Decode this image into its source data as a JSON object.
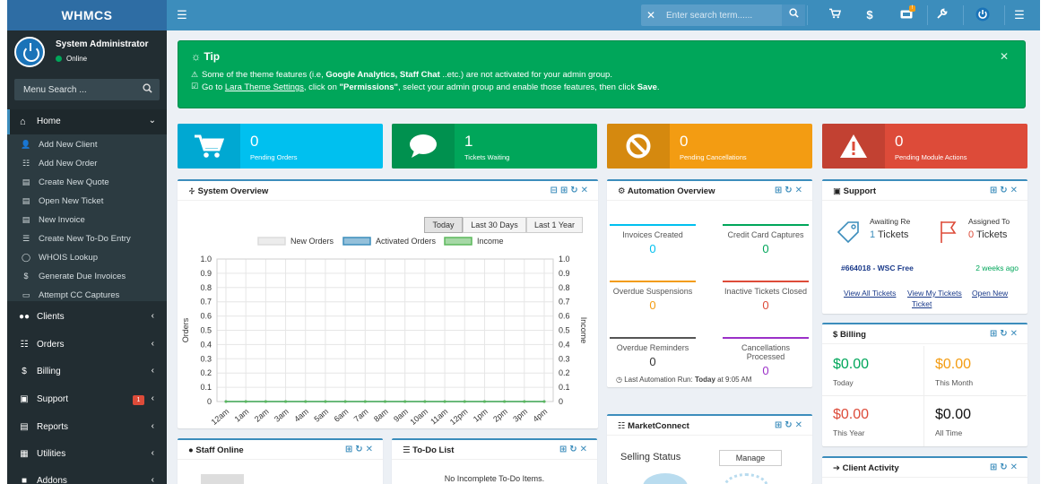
{
  "brand": "WHMCS",
  "topbar": {
    "search_placeholder": "Enter search term......",
    "icons": [
      "hamburger-icon",
      "close-icon",
      "search-icon",
      "cart-icon",
      "dollar-icon",
      "ticket-icon",
      "wrench-icon",
      "power-icon",
      "menu-icon"
    ]
  },
  "user": {
    "name": "System Administrator",
    "status": "Online"
  },
  "sidebar": {
    "search_placeholder": "Menu Search ...",
    "home_label": "Home",
    "submenu": [
      "Add New Client",
      "Add New Order",
      "Create New Quote",
      "Open New Ticket",
      "New Invoice",
      "Create New To-Do Entry",
      "WHOIS Lookup",
      "Generate Due Invoices",
      "Attempt CC Captures"
    ],
    "items": [
      {
        "label": "Clients"
      },
      {
        "label": "Orders"
      },
      {
        "label": "Billing"
      },
      {
        "label": "Support",
        "badge": "1"
      },
      {
        "label": "Reports"
      },
      {
        "label": "Utilities"
      },
      {
        "label": "Addons"
      }
    ]
  },
  "tip": {
    "title": "Tip",
    "line1_a": "Some of the theme features (i.e, ",
    "line1_b": "Google Analytics, Staff Chat",
    "line1_c": " ..etc.) are not activated for your admin group.",
    "line2_a": "Go to ",
    "line2_link": "Lara Theme Settings",
    "line2_b": ", click on ",
    "line2_c": "\"Permissions\"",
    "line2_d": ", select your admin group and enable those features, then click ",
    "line2_e": "Save",
    "line2_f": "."
  },
  "infoboxes": [
    {
      "value": "0",
      "label": "Pending Orders",
      "color": "#00c0ef"
    },
    {
      "value": "1",
      "label": "Tickets Waiting",
      "color": "#00a65a"
    },
    {
      "value": "0",
      "label": "Pending Cancellations",
      "color": "#f39c12"
    },
    {
      "value": "0",
      "label": "Pending Module Actions",
      "color": "#dd4b39"
    }
  ],
  "system_overview": {
    "title": "System Overview",
    "ranges": [
      "Today",
      "Last 30 Days",
      "Last 1 Year"
    ],
    "selected": "Today"
  },
  "chart_data": {
    "type": "line",
    "x": [
      "12am",
      "1am",
      "2am",
      "3am",
      "4am",
      "5am",
      "6am",
      "7am",
      "8am",
      "9am",
      "10am",
      "11am",
      "12pm",
      "1pm",
      "2pm",
      "3pm",
      "4pm"
    ],
    "series": [
      {
        "name": "New Orders",
        "color": "#dcdcdc",
        "values": [
          0,
          0,
          0,
          0,
          0,
          0,
          0,
          0,
          0,
          0,
          0,
          0,
          0,
          0,
          0,
          0,
          0
        ]
      },
      {
        "name": "Activated Orders",
        "color": "#3c8dbc",
        "values": [
          0,
          0,
          0,
          0,
          0,
          0,
          0,
          0,
          0,
          0,
          0,
          0,
          0,
          0,
          0,
          0,
          0
        ]
      },
      {
        "name": "Income",
        "color": "#5cb85c",
        "values": [
          0,
          0,
          0,
          0,
          0,
          0,
          0,
          0,
          0,
          0,
          0,
          0,
          0,
          0,
          0,
          0,
          0
        ]
      }
    ],
    "yticks": [
      "1.0",
      "0.9",
      "0.8",
      "0.7",
      "0.6",
      "0.5",
      "0.4",
      "0.3",
      "0.2",
      "0.1",
      "0"
    ],
    "ylabel": "Orders",
    "y2label": "Income",
    "ylim": [
      0,
      1.0
    ],
    "grid": true,
    "legend": "top"
  },
  "automation": {
    "title": "Automation Overview",
    "stats": [
      {
        "label": "Invoices Created",
        "value": "0",
        "color": "#00c0ef"
      },
      {
        "label": "Credit Card Captures",
        "value": "0",
        "color": "#00a65a"
      },
      {
        "label": "Overdue Suspensions",
        "value": "0",
        "color": "#f39c12"
      },
      {
        "label": "Inactive Tickets Closed",
        "value": "0",
        "color": "#dd4b39"
      },
      {
        "label": "Overdue Reminders",
        "value": "0",
        "color": "#555555"
      },
      {
        "label": "Cancellations Processed",
        "value": "0",
        "color": "#9b30c8"
      }
    ],
    "last_run_prefix": "Last Automation Run:",
    "last_run_day": "Today",
    "last_run_time": "at 9:05 AM"
  },
  "support": {
    "title": "Support",
    "awaiting_label": "Awaiting Re",
    "awaiting_count": "1",
    "awaiting_unit": "Tickets",
    "assigned_label": "Assigned To",
    "assigned_count": "0",
    "assigned_unit": "Tickets",
    "ticket": "#664018 - WSC Free",
    "ticket_age": "2 weeks ago",
    "links": [
      "View All Tickets",
      "View My Tickets",
      "Open New",
      "Ticket"
    ]
  },
  "billing": {
    "title": "Billing",
    "cells": [
      {
        "value": "$0.00",
        "period": "Today",
        "color": "#00a65a"
      },
      {
        "value": "$0.00",
        "period": "This Month",
        "color": "#f39c12"
      },
      {
        "value": "$0.00",
        "period": "This Year",
        "color": "#dd4b39"
      },
      {
        "value": "$0.00",
        "period": "All Time",
        "color": "#111111"
      }
    ]
  },
  "marketconnect": {
    "title": "MarketConnect",
    "selling_status": "Selling Status",
    "manage": "Manage"
  },
  "staff_online": {
    "title": "Staff Online"
  },
  "todo": {
    "title": "To-Do List",
    "empty": "No Incomplete To-Do Items."
  },
  "client_activity": {
    "title": "Client Activity"
  }
}
